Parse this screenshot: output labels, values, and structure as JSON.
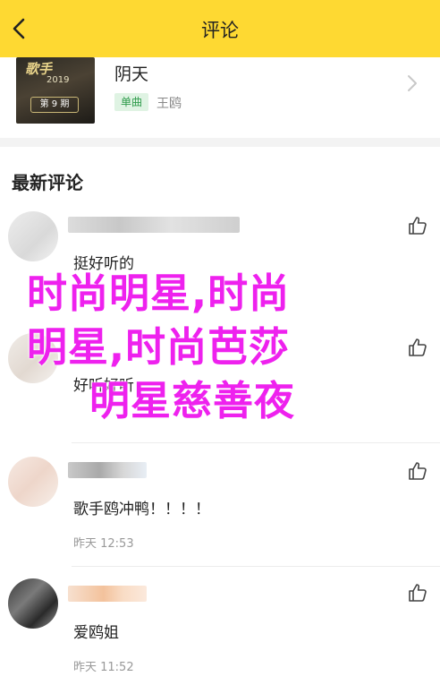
{
  "header": {
    "title": "评论"
  },
  "song": {
    "cover_text_top": "歌手",
    "cover_year": "2019",
    "cover_issue": "第 9 期",
    "title": "阴天",
    "badge": "单曲",
    "artist": "王鸥"
  },
  "section": {
    "title": "最新评论"
  },
  "comments": [
    {
      "text": "挺好听的",
      "time": ""
    },
    {
      "text": "好听好听",
      "time": ""
    },
    {
      "text": "歌手鸥冲鸭！！！！",
      "time": "昨天 12:53"
    },
    {
      "text": "爱鸥姐",
      "time": "昨天 11:52"
    }
  ],
  "overlay": {
    "line1": "时尚明星,时尚",
    "line2": "明星,时尚芭莎",
    "line3": "明星慈善夜"
  },
  "colors": {
    "topbar": "#fed932",
    "overlay_text": "#ee21ee",
    "badge_bg": "#dff3e3",
    "badge_text": "#2f9c4c"
  }
}
